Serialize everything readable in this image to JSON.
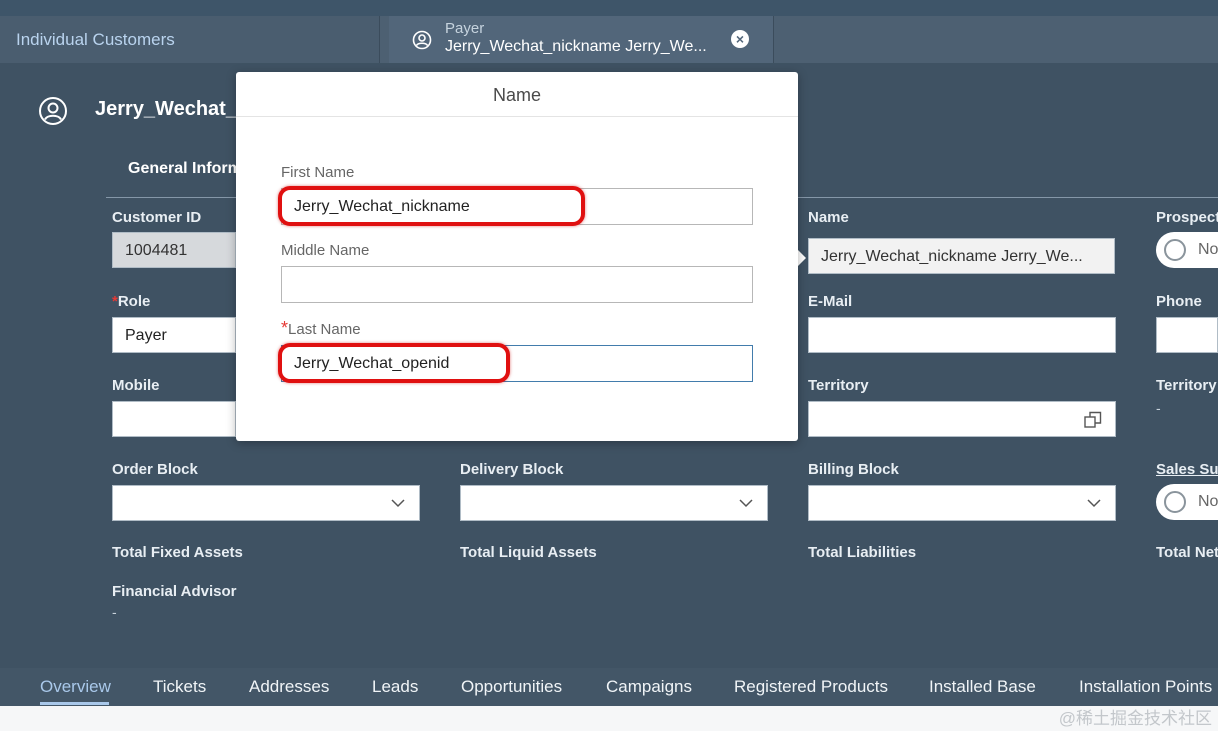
{
  "tabs": {
    "left_label": "Individual Customers",
    "active_subtitle": "Payer",
    "active_title": "Jerry_Wechat_nickname Jerry_We..."
  },
  "header": {
    "title": "Jerry_Wechat_nickname Jerry_Wechat_openid",
    "section_tab": "General Information"
  },
  "form": {
    "customer_id_label": "Customer ID",
    "customer_id_value": "1004481",
    "role_label": "Role",
    "role_value": "Payer",
    "mobile_label": "Mobile",
    "name_label": "Name",
    "name_value": "Jerry_Wechat_nickname Jerry_We...",
    "email_label": "E-Mail",
    "territory_label": "Territory",
    "prospect_label": "Prospect",
    "prospect_value": "No",
    "phone_label": "Phone",
    "territory2_label": "Territory",
    "territory2_value": "-",
    "order_block_label": "Order Block",
    "delivery_block_label": "Delivery Block",
    "billing_block_label": "Billing Block",
    "sales_label": "Sales Su",
    "sales_value": "No",
    "total_fixed_assets_label": "Total Fixed Assets",
    "total_liquid_assets_label": "Total Liquid Assets",
    "total_liabilities_label": "Total Liabilities",
    "total_net_label": "Total Net",
    "financial_advisor_label": "Financial Advisor",
    "financial_advisor_value": "-"
  },
  "popup": {
    "title": "Name",
    "first_name_label": "First Name",
    "first_name_value": "Jerry_Wechat_nickname",
    "middle_name_label": "Middle Name",
    "middle_name_value": "",
    "last_name_label": "Last Name",
    "last_name_value": "Jerry_Wechat_openid"
  },
  "bottom_tabs": [
    "Overview",
    "Tickets",
    "Addresses",
    "Leads",
    "Opportunities",
    "Campaigns",
    "Registered Products",
    "Installed Base",
    "Installation Points"
  ],
  "watermark": "@稀土掘金技术社区",
  "colors": {
    "background": "#3f5263",
    "accent": "#a9c8ea",
    "highlight": "#e01010"
  }
}
